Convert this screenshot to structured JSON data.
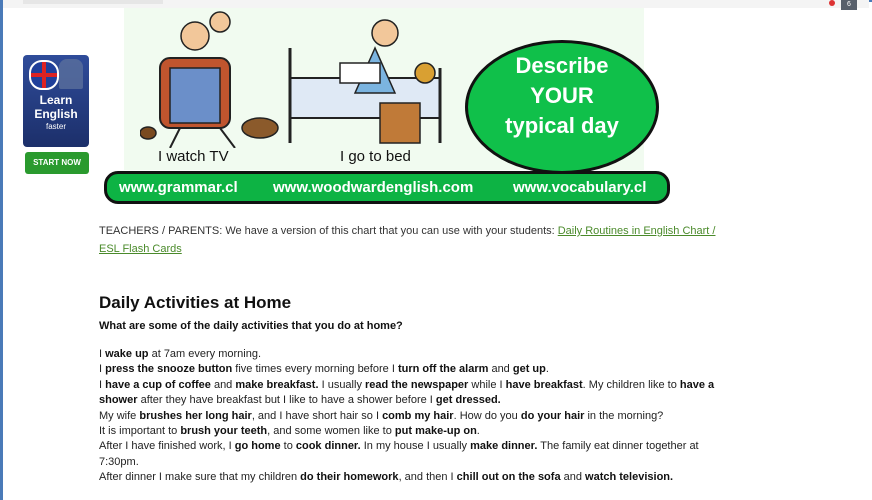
{
  "ad": {
    "line1": "Learn",
    "line2": "English",
    "line3": "faster",
    "button": "START NOW"
  },
  "banner": {
    "caption_left": "I watch TV",
    "caption_right": "I go to bed",
    "bubble": [
      "Describe",
      "YOUR",
      "typical day"
    ],
    "urls": [
      "www.grammar.cl",
      "www.woodwardenglish.com",
      "www.vocabulary.cl"
    ]
  },
  "note": {
    "text": "TEACHERS / PARENTS: We have a version of this chart that you can use with your students: ",
    "link": "Daily Routines in English Chart / ESL Flash Cards"
  },
  "article": {
    "title": "Daily Activities at Home",
    "question": "What are some of the daily activities that you do at home?",
    "lines": [
      [
        [
          "I ",
          false
        ],
        [
          "wake up",
          true
        ],
        [
          " at 7am every morning.",
          false
        ]
      ],
      [
        [
          "I ",
          false
        ],
        [
          "press the snooze button",
          true
        ],
        [
          " five times every morning before I ",
          false
        ],
        [
          "turn off the alarm",
          true
        ],
        [
          " and ",
          false
        ],
        [
          "get up",
          true
        ],
        [
          ".",
          false
        ]
      ],
      [
        [
          "I ",
          false
        ],
        [
          "have a cup of coffee",
          true
        ],
        [
          " and ",
          false
        ],
        [
          "make breakfast.",
          true
        ],
        [
          " I usually ",
          false
        ],
        [
          "read the newspaper",
          true
        ],
        [
          " while I ",
          false
        ],
        [
          "have breakfast",
          true
        ],
        [
          ". My children like to ",
          false
        ],
        [
          "have a shower",
          true
        ],
        [
          " after they have breakfast but I like to have a shower before I ",
          false
        ],
        [
          "get dressed.",
          true
        ]
      ],
      [
        [
          "My wife ",
          false
        ],
        [
          "brushes her long hair",
          true
        ],
        [
          ", and I have short hair so I ",
          false
        ],
        [
          "comb my hair",
          true
        ],
        [
          ". How do you ",
          false
        ],
        [
          "do your hair",
          true
        ],
        [
          " in the morning?",
          false
        ]
      ],
      [
        [
          "It is important to ",
          false
        ],
        [
          "brush your teeth",
          true
        ],
        [
          ", and some women like to ",
          false
        ],
        [
          "put make-up on",
          true
        ],
        [
          ".",
          false
        ]
      ],
      [
        [
          "After I have finished work, I ",
          false
        ],
        [
          "go home",
          true
        ],
        [
          " to ",
          false
        ],
        [
          "cook dinner.",
          true
        ],
        [
          " In my house I usually ",
          false
        ],
        [
          "make dinner.",
          true
        ],
        [
          " The family eat dinner together at 7:30pm.",
          false
        ]
      ],
      [
        [
          "After dinner I make sure that my children ",
          false
        ],
        [
          "do their homework",
          true
        ],
        [
          ", and then I ",
          false
        ],
        [
          "chill out on the sofa",
          true
        ],
        [
          " and ",
          false
        ],
        [
          "watch television.",
          true
        ]
      ]
    ]
  },
  "colors": {
    "banner_green": "#0db344",
    "link_green": "#4a8a2a",
    "ad_blue": "#2f4c9a"
  }
}
